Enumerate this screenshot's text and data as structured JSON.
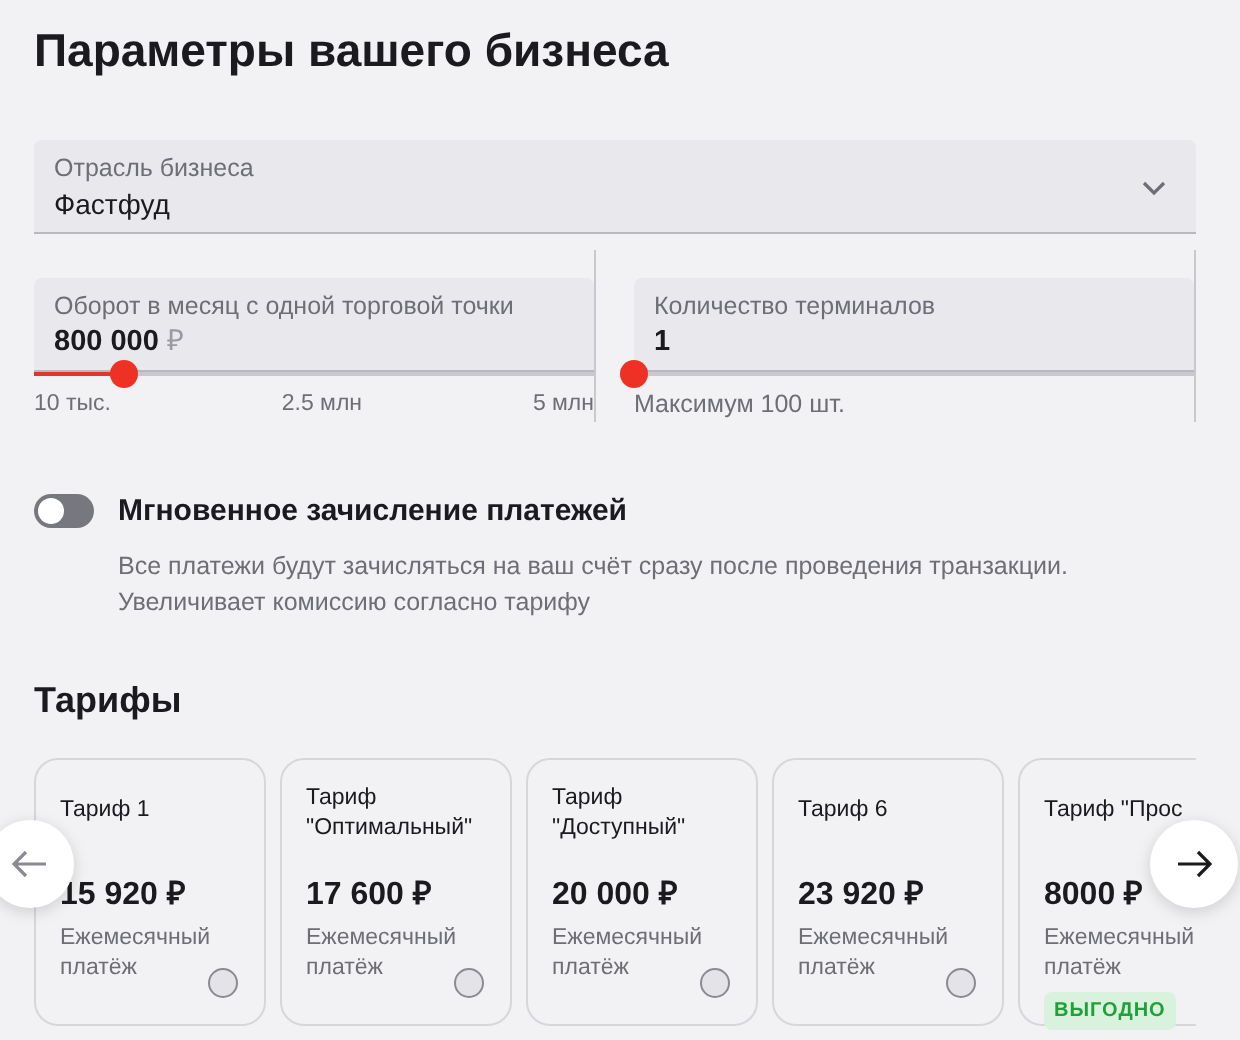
{
  "title": "Параметры вашего бизнеса",
  "industry": {
    "label": "Отрасль бизнеса",
    "value": "Фастфуд"
  },
  "turnover": {
    "label": "Оборот в месяц с одной торговой точки",
    "value": "800 000",
    "currency": "₽",
    "level": 0.16,
    "ticks": [
      "10 тыс.",
      "2.5 млн",
      "5 млн"
    ]
  },
  "terminals": {
    "label": "Количество терминалов",
    "value": "1",
    "level": 0,
    "hint": "Максимум 100 шт."
  },
  "instant": {
    "title": "Мгновенное зачисление платежей",
    "on": false,
    "description": "Все платежи будут зачисляться на ваш счёт сразу после проведения транзакции. Увеличивает комиссию согласно тарифу"
  },
  "tariffs_heading": "Тарифы",
  "tariffs": [
    {
      "name": "Тариф 1",
      "price": "15 920 ₽",
      "period": "Ежемесячный платёж",
      "selected": false
    },
    {
      "name": "Тариф \"Оптимальный\"",
      "price": "17 600 ₽",
      "period": "Ежемесячный платёж",
      "selected": false
    },
    {
      "name": "Тариф \"Доступный\"",
      "price": "20 000 ₽",
      "period": "Ежемесячный платёж",
      "selected": false
    },
    {
      "name": "Тариф 6",
      "price": "23 920 ₽",
      "period": "Ежемесячный платёж",
      "selected": false
    },
    {
      "name": "Тариф \"Прос",
      "price": "8000 ₽",
      "period": "Ежемесячный платёж",
      "badge": "ВЫГОДНО"
    }
  ]
}
